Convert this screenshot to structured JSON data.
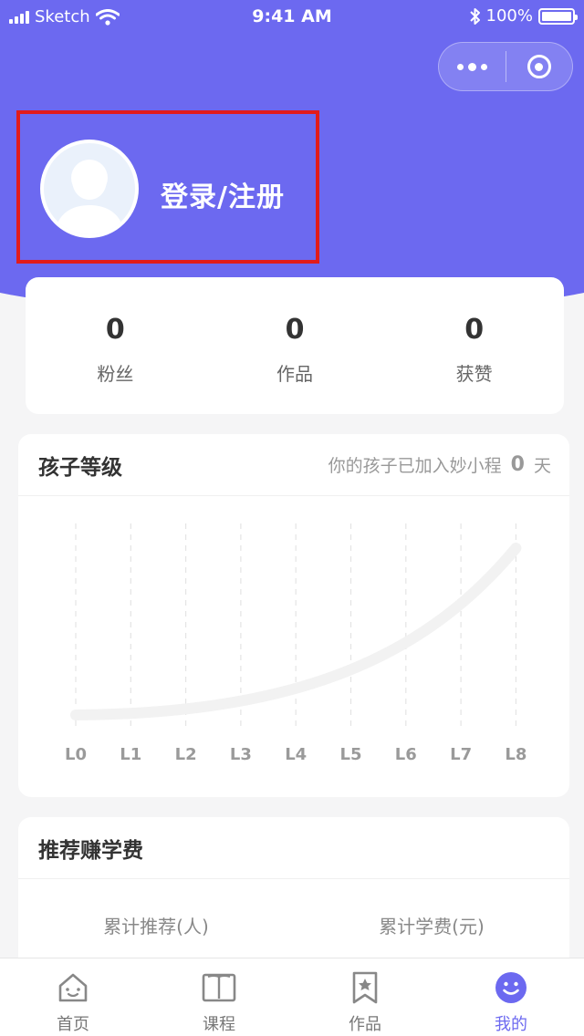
{
  "status_bar": {
    "carrier": "Sketch",
    "time": "9:41 AM",
    "battery": "100%"
  },
  "profile": {
    "login_label": "登录/注册"
  },
  "stats": [
    {
      "value": "0",
      "label": "粉丝"
    },
    {
      "value": "0",
      "label": "作品"
    },
    {
      "value": "0",
      "label": "获赞"
    }
  ],
  "level_card": {
    "title": "孩子等级",
    "joined_prefix": "你的孩子已加入妙小程",
    "joined_days": "0",
    "joined_suffix": "天",
    "levels": [
      "L0",
      "L1",
      "L2",
      "L3",
      "L4",
      "L5",
      "L6",
      "L7",
      "L8"
    ]
  },
  "chart_data": {
    "type": "line",
    "categories": [
      "L0",
      "L1",
      "L2",
      "L3",
      "L4",
      "L5",
      "L6",
      "L7",
      "L8"
    ],
    "grid": "vertical-dashed",
    "line_color": "#f2f2f2"
  },
  "refer_card": {
    "title": "推荐赚学费",
    "col1_label": "累计推荐(人)",
    "col2_label": "累计学费(元)"
  },
  "tabs": [
    {
      "label": "首页",
      "icon": "home-icon"
    },
    {
      "label": "课程",
      "icon": "book-icon"
    },
    {
      "label": "作品",
      "icon": "bookmark-star-icon"
    },
    {
      "label": "我的",
      "icon": "smile-icon",
      "active": true
    }
  ],
  "colors": {
    "brand": "#6c69f0",
    "highlight_border": "#e21b1b"
  }
}
